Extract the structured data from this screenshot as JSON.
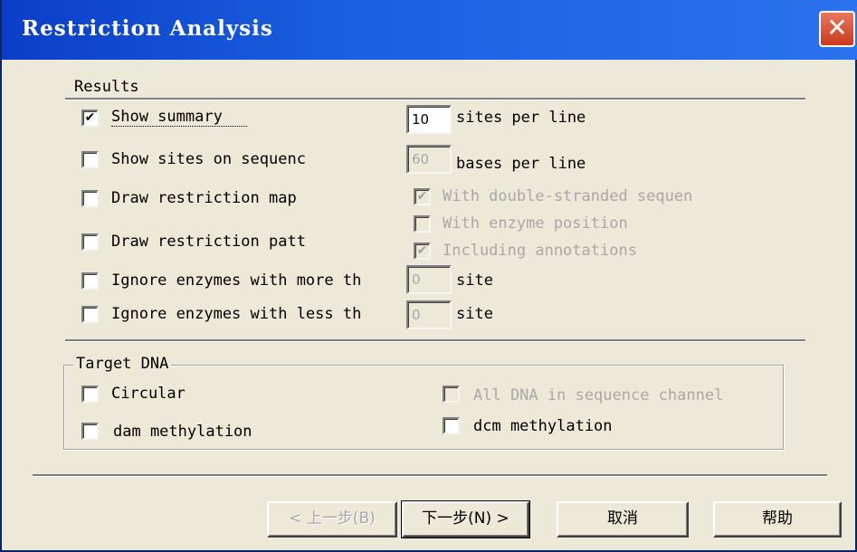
{
  "window": {
    "title": "Restriction Analysis",
    "close_glyph": "✕"
  },
  "results": {
    "legend": "Results",
    "show_summary": {
      "label": "Show summary",
      "checked": true
    },
    "sites_per_line": {
      "value": "10",
      "label": "sites per line"
    },
    "show_sites": {
      "label": "Show sites on sequenc",
      "checked": false
    },
    "bases_per_line": {
      "value": "60",
      "label": "bases per line"
    },
    "draw_map": {
      "label": "Draw restriction map",
      "checked": false
    },
    "double_stranded": {
      "label": "With double-stranded sequen",
      "checked": true
    },
    "enzyme_position": {
      "label": "With enzyme position",
      "checked": false
    },
    "draw_pattern": {
      "label": "Draw restriction patt",
      "checked": false
    },
    "including_annotations": {
      "label": "Including annotations",
      "checked": true
    },
    "ignore_more": {
      "label": "Ignore enzymes with more th",
      "value": "0",
      "unit": "site"
    },
    "ignore_less": {
      "label": "Ignore enzymes with less th",
      "value": "0",
      "unit": "site"
    }
  },
  "target_dna": {
    "legend": "Target DNA",
    "circular": {
      "label": "Circular",
      "checked": false
    },
    "all_dna": {
      "label": "All DNA in sequence channel",
      "checked": false
    },
    "dam": {
      "label": "dam methylation",
      "checked": false
    },
    "dcm": {
      "label": "dcm methylation",
      "checked": false
    }
  },
  "buttons": {
    "back": "< 上一步(B)",
    "next": "下一步(N) >",
    "cancel": "取消",
    "help": "帮助"
  },
  "icons": {
    "check": "✔",
    "close": "close-icon"
  },
  "colors": {
    "titlebar": "#1a5fe0",
    "dialog_bg": "#ece9d8",
    "close_button": "#d3502f"
  }
}
